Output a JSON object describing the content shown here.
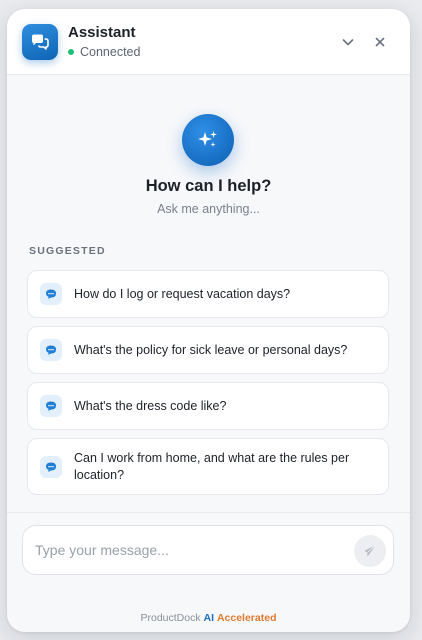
{
  "header": {
    "title": "Assistant",
    "status": "Connected",
    "status_color": "#1fbf7a",
    "avatar_icon": "chat-bubbles-icon",
    "minimize_icon": "chevron-down-icon",
    "close_icon": "close-icon"
  },
  "hero": {
    "icon": "sparkles-icon",
    "title": "How can I help?",
    "subtitle": "Ask me anything..."
  },
  "suggestions": {
    "label": "SUGGESTED",
    "items": [
      {
        "icon": "chat-bubble-icon",
        "text": "How do I log or request vacation days?"
      },
      {
        "icon": "chat-bubble-icon",
        "text": "What's the policy for sick leave or personal days?"
      },
      {
        "icon": "chat-bubble-icon",
        "text": "What's the dress code like?"
      },
      {
        "icon": "chat-bubble-icon",
        "text": "Can I work from home, and what are the rules per location?"
      }
    ]
  },
  "composer": {
    "value": "",
    "placeholder": "Type your message...",
    "send_icon": "send-icon"
  },
  "branding": {
    "brand": "ProductDock",
    "ai": "AI",
    "accelerated": "Accelerated"
  },
  "colors": {
    "accent": "#1f6fc0",
    "accent_secondary": "#e07a2e"
  }
}
